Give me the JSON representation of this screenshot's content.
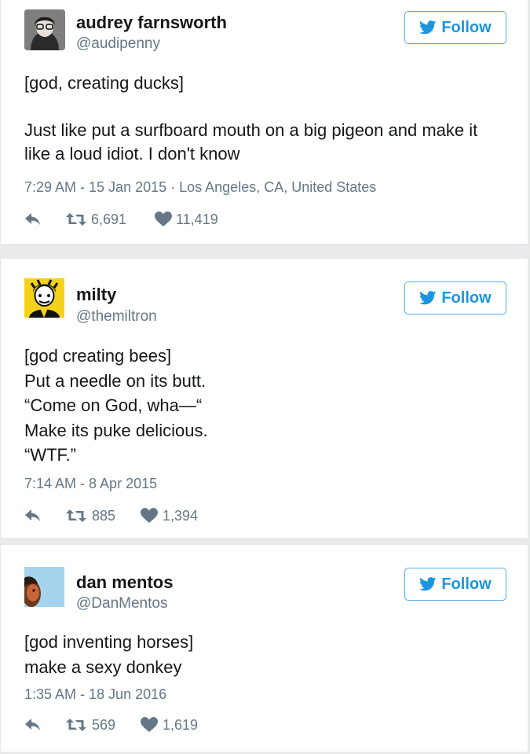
{
  "tweets": [
    {
      "name": "audrey farnsworth",
      "handle": "@audipenny",
      "follow_label": "Follow",
      "lines": [
        "[god, creating ducks]",
        "",
        "Just like put a surfboard mouth on a big pigeon and make it",
        "like a loud idiot. I don't know"
      ],
      "meta": "7:29 AM - 15 Jan 2015 · Los Angeles, CA, United States",
      "retweets": "6,691",
      "likes": "11,419"
    },
    {
      "name": "milty",
      "handle": "@themiltron",
      "follow_label": "Follow",
      "lines": [
        "[god creating bees]",
        "Put a needle on its butt.",
        "“Come on God, wha—“",
        "Make its puke delicious.",
        "“WTF.”"
      ],
      "meta": "7:14 AM - 8 Apr 2015",
      "retweets": "885",
      "likes": "1,394"
    },
    {
      "name": "dan mentos",
      "handle": "@DanMentos",
      "follow_label": "Follow",
      "lines": [
        "[god inventing horses]",
        "make a sexy donkey"
      ],
      "meta": "1:35 AM - 18 Jun 2016",
      "retweets": "569",
      "likes": "1,619"
    }
  ],
  "icons": {
    "reply": "reply-icon",
    "retweet": "retweet-icon",
    "like": "heart-icon",
    "follow": "twitter-bird-icon"
  },
  "colors": {
    "accent": "#1b95e0",
    "muted": "#657786",
    "text": "#14171a"
  }
}
